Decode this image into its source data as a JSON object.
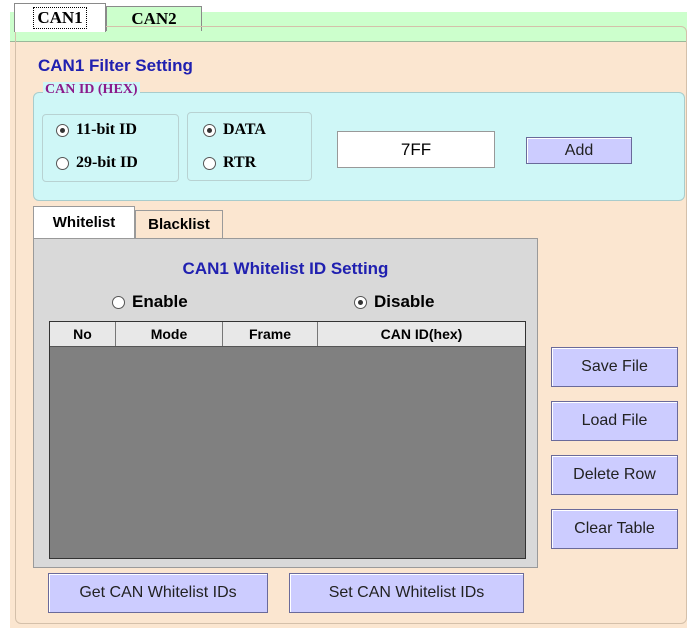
{
  "tabs": [
    {
      "label": "CAN1",
      "active": true
    },
    {
      "label": "CAN2",
      "active": false
    }
  ],
  "filter": {
    "title": "CAN1 Filter Setting",
    "canid_legend": "CAN ID (HEX)",
    "id_bits": {
      "options": [
        "11-bit ID",
        "29-bit ID"
      ],
      "selected": "11-bit ID"
    },
    "frame_type": {
      "options": [
        "DATA",
        "RTR"
      ],
      "selected": "DATA"
    },
    "id_value": "7FF",
    "add_label": "Add"
  },
  "list_tabs": [
    {
      "label": "Whitelist",
      "active": true
    },
    {
      "label": "Blacklist",
      "active": false
    }
  ],
  "whitelist": {
    "title": "CAN1 Whitelist ID Setting",
    "enable_label": "Enable",
    "disable_label": "Disable",
    "selected": "Disable",
    "columns": [
      "No",
      "Mode",
      "Frame",
      "CAN ID(hex)"
    ],
    "rows": []
  },
  "side_buttons": {
    "save": "Save File",
    "load": "Load File",
    "delete_row": "Delete Row",
    "clear": "Clear Table"
  },
  "bottom_buttons": {
    "get": "Get CAN Whitelist IDs",
    "set": "Set CAN Whitelist IDs"
  },
  "colors": {
    "accent_blue": "#2020b0",
    "legend_purple": "#8b1a8b",
    "button_bg": "#ccccff",
    "panel_bg": "#fbe6d0",
    "canid_bg": "#cff7f7",
    "tab_strip_bg": "#ccffcc"
  }
}
